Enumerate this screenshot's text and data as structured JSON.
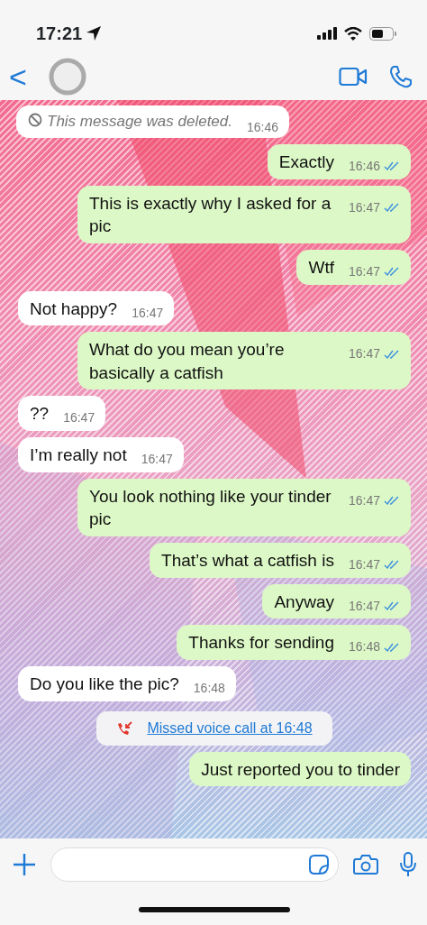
{
  "status_bar": {
    "time": "17:21"
  },
  "header": {
    "back": "<"
  },
  "messages": [
    {
      "kind": "deleted",
      "text": "This message was deleted.",
      "time": "16:46"
    },
    {
      "kind": "out",
      "text": "Exactly",
      "time": "16:46",
      "read": true
    },
    {
      "kind": "out",
      "text": "This is exactly why I asked for a pic",
      "time": "16:47",
      "read": true
    },
    {
      "kind": "out",
      "text": "Wtf",
      "time": "16:47",
      "read": true
    },
    {
      "kind": "in",
      "text": "Not happy?",
      "time": "16:47"
    },
    {
      "kind": "out",
      "text": "What do you mean you’re basically a catfish",
      "time": "16:47",
      "read": true
    },
    {
      "kind": "in",
      "text": "??",
      "time": "16:47"
    },
    {
      "kind": "in",
      "text": "I’m really not",
      "time": "16:47"
    },
    {
      "kind": "out",
      "text": "You look nothing like your tinder pic",
      "time": "16:47",
      "read": true
    },
    {
      "kind": "out",
      "text": "That’s what a catfish is",
      "time": "16:47",
      "read": true
    },
    {
      "kind": "out",
      "text": "Anyway",
      "time": "16:47",
      "read": true
    },
    {
      "kind": "out",
      "text": "Thanks for sending",
      "time": "16:48",
      "read": true
    },
    {
      "kind": "in",
      "text": "Do you like the pic?",
      "time": "16:48"
    },
    {
      "kind": "missed_call",
      "text": "Missed voice call at 16:48"
    },
    {
      "kind": "out",
      "text": "Just reported you to tinder"
    }
  ]
}
